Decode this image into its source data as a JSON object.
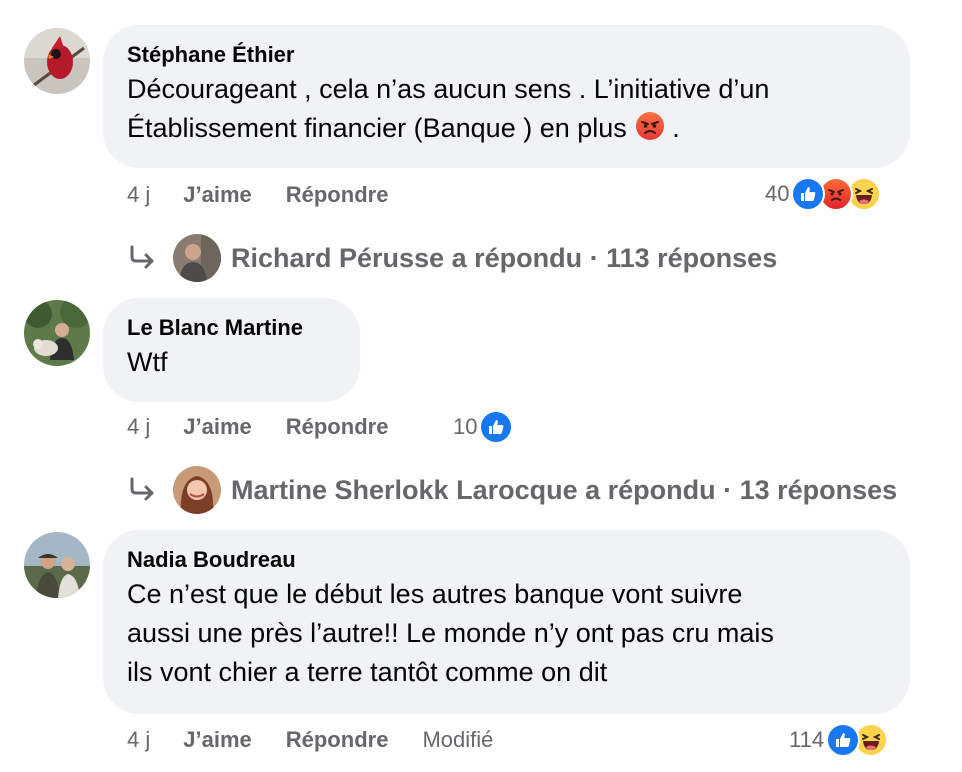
{
  "comments": [
    {
      "author": "Stéphane Éthier",
      "text_line1": "Décourageant , cela n’as aucun sens . L’initiative d’un",
      "text_line2": "Établissement financier (Banque ) en plus",
      "text_line2_end": " .",
      "inline_emoji": "angry-face-icon",
      "time": "4 j",
      "like_label": "J’aime",
      "reply_label": "Répondre",
      "reaction_count": "40",
      "reactions": [
        "like-icon",
        "angry-icon",
        "haha-icon"
      ],
      "reply_summary": {
        "text": "Richard Pérusse a répondu · 113 réponses"
      }
    },
    {
      "author": "Le Blanc Martine",
      "text": "Wtf",
      "time": "4 j",
      "like_label": "J’aime",
      "reply_label": "Répondre",
      "reaction_count": "10",
      "reactions": [
        "like-icon"
      ],
      "reply_summary": {
        "text": "Martine Sherlokk Larocque a répondu · 13 réponses"
      }
    },
    {
      "author": "Nadia Boudreau",
      "text_line1": "Ce n’est que le début les autres banque vont suivre",
      "text_line2": "aussi une près l’autre!! Le monde n’y ont pas cru mais",
      "text_line3": "ils vont chier a terre tantôt comme on dit",
      "time": "4 j",
      "like_label": "J’aime",
      "reply_label": "Répondre",
      "edited_label": "Modifié",
      "reaction_count": "114",
      "reactions": [
        "like-icon",
        "haha-icon"
      ]
    }
  ],
  "colors": {
    "bubble": "#f0f2f5",
    "meta_text": "#65676b",
    "like_blue": "#1877f2",
    "haha_yellow": "#fcd34d",
    "angry_red": "#e1232a"
  }
}
